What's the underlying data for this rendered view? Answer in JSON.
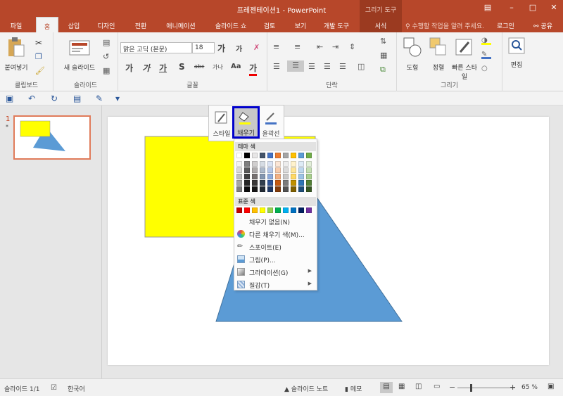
{
  "window": {
    "title": "프레젠테이션1 - PowerPoint",
    "context_group": "그리기 도구",
    "controls": [
      "ribbon-display",
      "minimize",
      "maximize",
      "close"
    ]
  },
  "tabs": [
    {
      "label": "파일"
    },
    {
      "label": "홈"
    },
    {
      "label": "삽입"
    },
    {
      "label": "디자인"
    },
    {
      "label": "전환"
    },
    {
      "label": "애니메이션"
    },
    {
      "label": "슬라이드 쇼"
    },
    {
      "label": "검토"
    },
    {
      "label": "보기"
    },
    {
      "label": "개발 도구"
    },
    {
      "label": "서식"
    }
  ],
  "tell_me": "수행할 작업을 알려 주세요.",
  "sign_in": "로그인",
  "share": "공유",
  "ribbon": {
    "clipboard": {
      "group_label": "클립보드",
      "paste_label": "붙여넣기"
    },
    "slides": {
      "group_label": "슬라이드",
      "new_slide_label": "새 슬라이드"
    },
    "font": {
      "group_label": "글꼴",
      "font_name": "맑은 고딕 (본문)",
      "font_size": "18",
      "grow": "가",
      "shrink": "가",
      "bold": "가",
      "italic": "가",
      "underline": "가",
      "shadow": "S",
      "strike": "abc",
      "spacing": "가나",
      "case": "Aa",
      "color": "가"
    },
    "paragraph": {
      "group_label": "단락"
    },
    "drawing": {
      "group_label": "그리기",
      "shape_label": "도형",
      "arrange_label": "정렬",
      "quick_styles_label": "빠른 스타일"
    },
    "editing": {
      "label": "편집"
    }
  },
  "thumb_pane": {
    "slide_number": "1",
    "star": "*"
  },
  "mini_toolbar": {
    "style_label": "스타일",
    "fill_label": "채우기",
    "outline_label": "윤곽선"
  },
  "fill_menu": {
    "theme_colors_header": "테마 색",
    "standard_colors_header": "표준 색",
    "theme_top_row": [
      "#ffffff",
      "#000000",
      "#e7e6e6",
      "#44546a",
      "#4472c4",
      "#ed7d31",
      "#a5a5a5",
      "#ffc000",
      "#5b9bd5",
      "#70ad47"
    ],
    "theme_shades": [
      [
        "#f2f2f2",
        "#7f7f7f",
        "#d0cece",
        "#d6dce4",
        "#d9e2f3",
        "#fbe5d5",
        "#ededed",
        "#fff2cc",
        "#deebf6",
        "#e2efd9"
      ],
      [
        "#d8d8d8",
        "#595959",
        "#aeabab",
        "#adb9ca",
        "#b4c6e7",
        "#f7cbac",
        "#dbdbdb",
        "#fee599",
        "#bdd7ee",
        "#c5e0b3"
      ],
      [
        "#bfbfbf",
        "#3f3f3f",
        "#757070",
        "#8496b0",
        "#8eaadb",
        "#f4b183",
        "#c9c9c9",
        "#ffd965",
        "#9cc3e5",
        "#a8d08d"
      ],
      [
        "#a5a5a5",
        "#262626",
        "#3a3838",
        "#323f4f",
        "#2f5496",
        "#c55a11",
        "#7b7b7b",
        "#bf9000",
        "#2e75b5",
        "#538135"
      ],
      [
        "#7f7f7f",
        "#0c0c0c",
        "#171616",
        "#222a35",
        "#1f3864",
        "#833c0b",
        "#525252",
        "#7f6000",
        "#1e4e79",
        "#375623"
      ]
    ],
    "standard_row": [
      "#c00000",
      "#ff0000",
      "#ffc000",
      "#ffff00",
      "#92d050",
      "#00b050",
      "#00b0f0",
      "#0070c0",
      "#002060",
      "#7030a0"
    ],
    "no_fill": "채우기 없음(N)",
    "more_colors": "다른 채우기 색(M)...",
    "eyedropper": "스포이트(E)",
    "picture": "그림(P)...",
    "gradient": "그라데이션(G)",
    "texture": "질감(T)"
  },
  "slide_shapes": {
    "rectangle_fill": "#ffff00",
    "triangle_fill": "#5b9bd5"
  },
  "status_bar": {
    "slide_info": "슬라이드 1/1",
    "language": "한국어",
    "notes": "슬라이드 노트",
    "comments": "메모",
    "zoom_minus": "−",
    "zoom_plus": "+",
    "zoom": "65 %"
  }
}
